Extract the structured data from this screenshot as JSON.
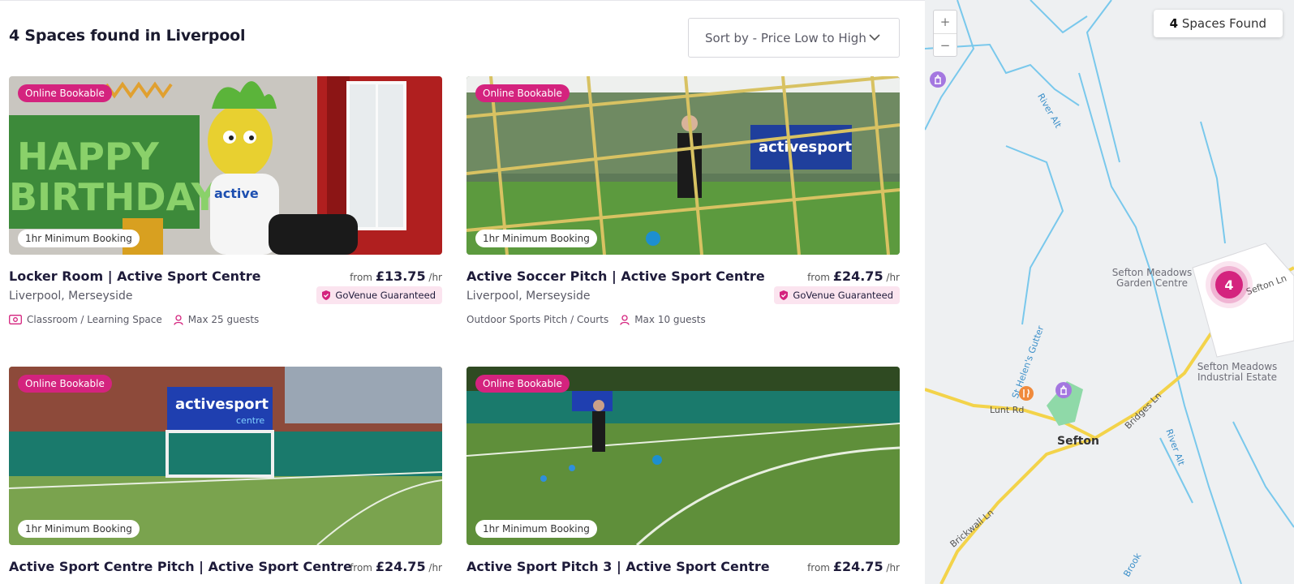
{
  "header": {
    "results_title": "4 Spaces found in Liverpool",
    "sort_label": "Sort by - Price Low to High"
  },
  "cards": [
    {
      "online_badge": "Online Bookable",
      "min_badge": "1hr Minimum Booking",
      "name": "Locker Room | Active Sport Centre",
      "from": "from",
      "price": "£13.75",
      "per": "/hr",
      "location": "Liverpool, Merseyside",
      "guarantee": "GoVenue Guaranteed",
      "type": "Classroom / Learning Space",
      "guests": "Max 25 guests"
    },
    {
      "online_badge": "Online Bookable",
      "min_badge": "1hr Minimum Booking",
      "name": "Active Soccer Pitch | Active Sport Centre",
      "from": "from",
      "price": "£24.75",
      "per": "/hr",
      "location": "Liverpool, Merseyside",
      "guarantee": "GoVenue Guaranteed",
      "type": "Outdoor Sports Pitch / Courts",
      "guests": "Max 10 guests"
    },
    {
      "online_badge": "Online Bookable",
      "min_badge": "1hr Minimum Booking",
      "name": "Active Sport Centre Pitch | Active Sport Centre",
      "from": "from",
      "price": "£24.75",
      "per": "/hr"
    },
    {
      "online_badge": "Online Bookable",
      "min_badge": "1hr Minimum Booking",
      "name": "Active Sport Pitch 3 | Active Sport Centre",
      "from": "from",
      "price": "£24.75",
      "per": "/hr"
    }
  ],
  "photo_text": {
    "banner_1": "HAPPY",
    "banner_2": "BIRTHDAY",
    "mascot": "active",
    "sign_1": "activesport",
    "sign_2": "centre"
  },
  "map": {
    "zoom_in": "+",
    "zoom_out": "−",
    "found_count": "4",
    "found_label": "Spaces Found",
    "cluster_count": "4",
    "labels": {
      "garden_centre": "Sefton Meadows Garden Centre",
      "industrial": "Sefton Meadows Industrial Estate",
      "sefton": "Sefton",
      "lunt_rd": "Lunt Rd",
      "bridges_ln": "Bridges Ln",
      "brickwall_ln": "Brickwall Ln",
      "sefton_ln": "Sefton Ln",
      "river_alt_1": "River Alt",
      "river_alt_2": "River Alt",
      "st_helens": "St Helen's Gutter",
      "brook": "Brook"
    }
  },
  "colors": {
    "brand_pink": "#d4237e",
    "text_dark": "#1e1b3a",
    "guarantee_bg": "#fbe4ef"
  }
}
